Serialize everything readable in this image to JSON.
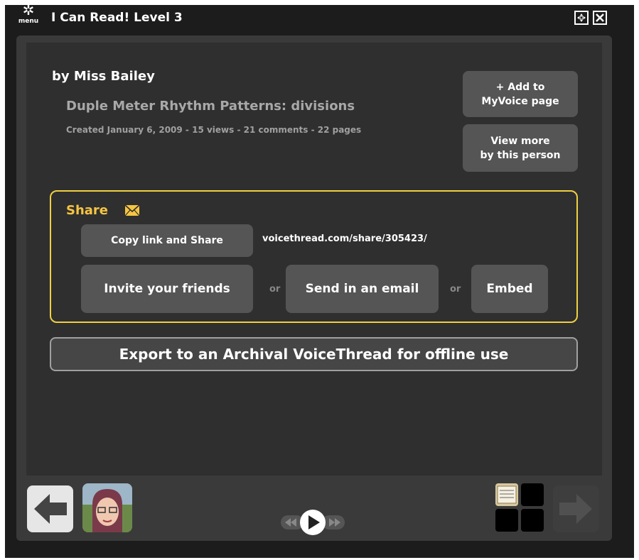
{
  "titlebar": {
    "menu_label": "menu",
    "title": "I Can Read! Level 3",
    "resize_icon": "resize-icon",
    "close_icon": "close-icon"
  },
  "info": {
    "author": "by Miss Bailey",
    "title": "Duple Meter Rhythm Patterns: divisions",
    "meta": "Created January 6, 2009 - 15 views - 21 comments - 22 pages"
  },
  "side_buttons": {
    "add_line1": "+ Add to",
    "add_line2": "MyVoice page",
    "more_line1": "View more",
    "more_line2": "by this person"
  },
  "share": {
    "heading": "Share",
    "copy_label": "Copy link and Share",
    "url": "voicethread.com/share/305423/",
    "invite_label": "Invite your friends",
    "or1": "or",
    "email_label": "Send in an email",
    "or2": "or",
    "embed_label": "Embed"
  },
  "export": {
    "label": "Export to an Archival VoiceThread for offline use"
  },
  "colors": {
    "accent": "#f5c542",
    "panel": "#2f2f2f",
    "button": "#555555"
  }
}
